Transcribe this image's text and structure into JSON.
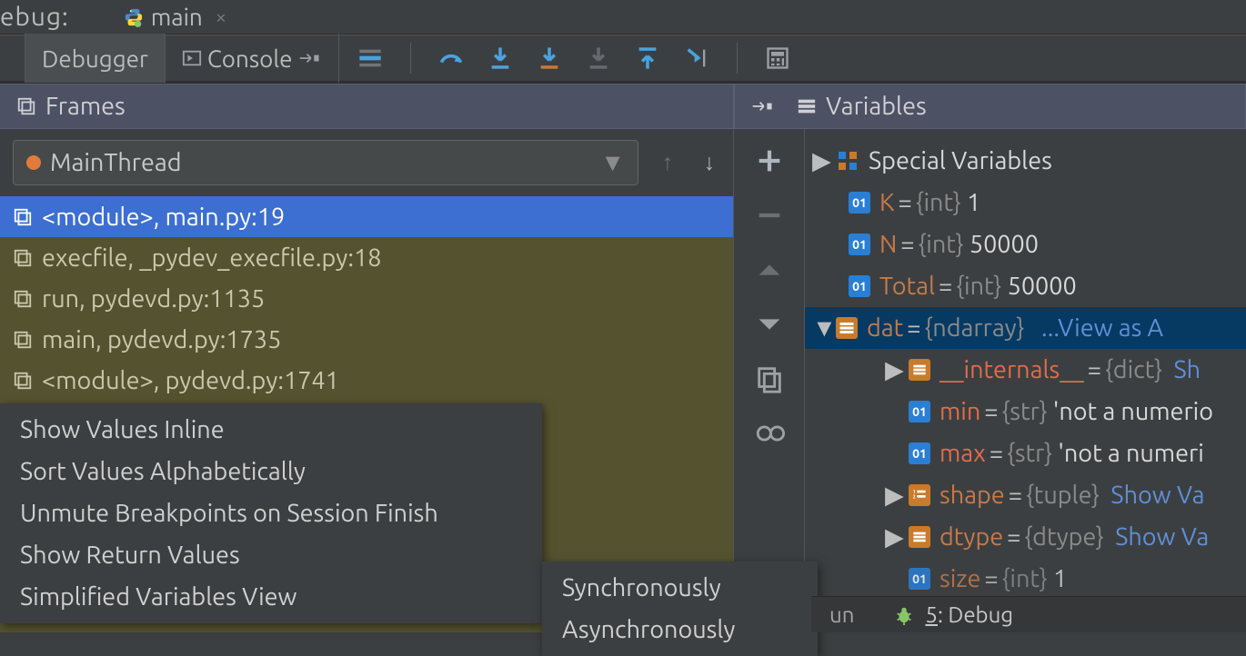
{
  "top": {
    "debug_label": "ebug:",
    "file_tab": "main",
    "close_glyph": "×"
  },
  "toolbar": {
    "tab_debugger": "Debugger",
    "tab_console": "Console"
  },
  "headers": {
    "frames": "Frames",
    "variables": "Variables"
  },
  "thread": {
    "name": "MainThread"
  },
  "frames": [
    "<module>, main.py:19",
    "execfile, _pydev_execfile.py:18",
    "run, pydevd.py:1135",
    "main, pydevd.py:1735",
    "<module>, pydevd.py:1741"
  ],
  "variables": {
    "special_label": "Special Variables",
    "items": [
      {
        "name": "K",
        "type": "{int}",
        "value": "1",
        "badge": "int"
      },
      {
        "name": "N",
        "type": "{int}",
        "value": "50000",
        "badge": "int"
      },
      {
        "name": "Total",
        "type": "{int}",
        "value": "50000",
        "badge": "int"
      }
    ],
    "dat": {
      "name": "dat",
      "type": "{ndarray}",
      "link": "...View as A"
    },
    "dat_children": [
      {
        "tri": true,
        "badge": "struct",
        "name": "__internals__",
        "type": "{dict}",
        "link": "Sh",
        "red": true
      },
      {
        "tri": false,
        "badge": "int",
        "name": "min",
        "type": "{str}",
        "value": "'not a numerio",
        "red": true
      },
      {
        "tri": false,
        "badge": "int",
        "name": "max",
        "type": "{str}",
        "value": "'not a numeri",
        "red": true
      },
      {
        "tri": true,
        "badge": "struct",
        "name": "shape",
        "type": "{tuple}",
        "link": "Show Va"
      },
      {
        "tri": true,
        "badge": "struct",
        "name": "dtype",
        "type": "{dtype}",
        "link": "Show Va"
      },
      {
        "tri": false,
        "badge": "int",
        "name": "size",
        "type": "{int}",
        "value": "1"
      }
    ]
  },
  "menu1": [
    "Show Values Inline",
    "Sort Values Alphabetically",
    "Unmute Breakpoints on Session Finish",
    "Show Return Values",
    "Simplified Variables View"
  ],
  "menu2": [
    "Synchronously",
    "Asynchronously"
  ],
  "status": {
    "run_frag": "un",
    "label": "5: Debug",
    "underline_char": "5"
  }
}
